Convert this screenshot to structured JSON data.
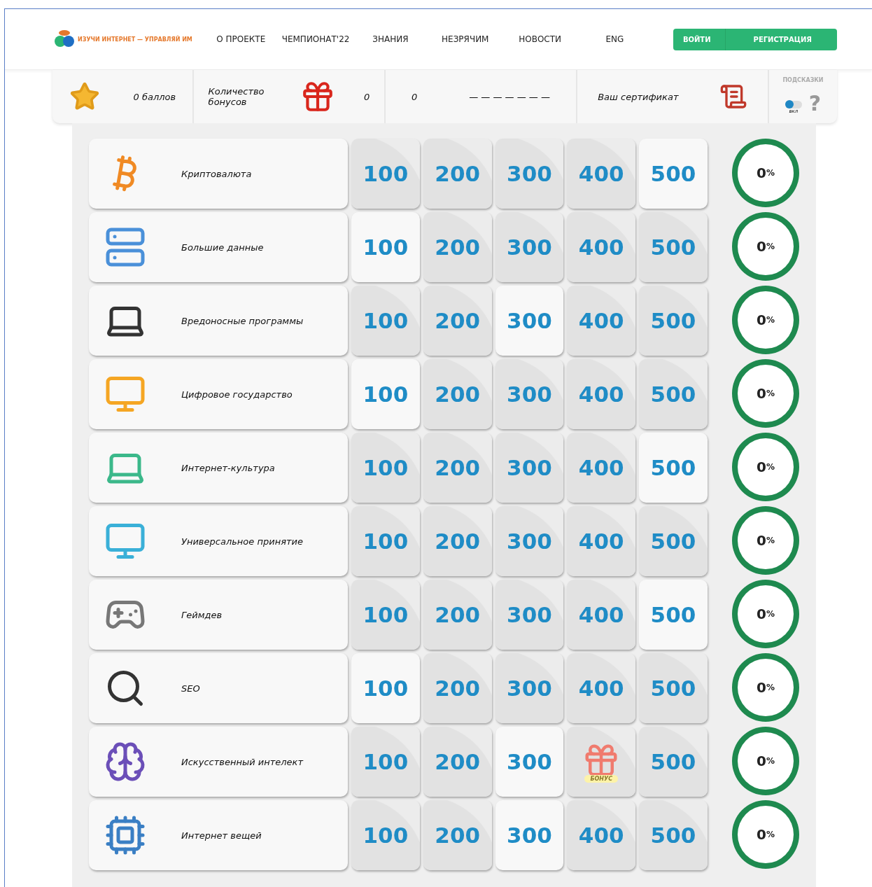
{
  "header": {
    "logo_text": "ИЗУЧИ ИНТЕРНЕТ — УПРАВЛЯЙ ИМ",
    "nav": [
      "О ПРОЕКТЕ",
      "ЧЕМПИОНАТ'22",
      "ЗНАНИЯ",
      "НЕЗРЯЧИМ",
      "НОВОСТИ",
      "ENG"
    ],
    "buttons": [
      "ВОЙТИ",
      "РЕГИСТРАЦИЯ"
    ]
  },
  "stats": {
    "points": "0 баллов",
    "bonus_label": "Количество бонусов",
    "bonus_count": "0",
    "value": "0",
    "dashes": "— — — — — — —",
    "certificate": "Ваш сертификат",
    "hints_label": "ПОДСКАЗКИ",
    "hints_toggle": {
      "on": false,
      "label": "вкл"
    },
    "help": "?"
  },
  "topics": [
    {
      "name": "Криптовалюта",
      "progress": "0",
      "unit": "%",
      "cells": [
        {
          "kind": "number",
          "text": "100",
          "open": false
        },
        {
          "kind": "number",
          "text": "200",
          "open": false
        },
        {
          "kind": "number",
          "text": "300",
          "open": false
        },
        {
          "kind": "number",
          "text": "400",
          "open": false
        },
        {
          "kind": "number",
          "text": "500",
          "open": true
        }
      ]
    },
    {
      "name": "Большие данные",
      "progress": "0",
      "unit": "%",
      "cells": [
        {
          "kind": "number",
          "text": "100",
          "open": true
        },
        {
          "kind": "number",
          "text": "200",
          "open": false
        },
        {
          "kind": "number",
          "text": "300",
          "open": false
        },
        {
          "kind": "number",
          "text": "400",
          "open": false
        },
        {
          "kind": "number",
          "text": "500",
          "open": false
        }
      ]
    },
    {
      "name": "Вредоносные программы",
      "progress": "0",
      "unit": "%",
      "cells": [
        {
          "kind": "number",
          "text": "100",
          "open": false
        },
        {
          "kind": "number",
          "text": "200",
          "open": false
        },
        {
          "kind": "number",
          "text": "300",
          "open": true
        },
        {
          "kind": "number",
          "text": "400",
          "open": false
        },
        {
          "kind": "number",
          "text": "500",
          "open": false
        }
      ]
    },
    {
      "name": "Цифровое государство",
      "progress": "0",
      "unit": "%",
      "cells": [
        {
          "kind": "number",
          "text": "100",
          "open": true
        },
        {
          "kind": "number",
          "text": "200",
          "open": false
        },
        {
          "kind": "number",
          "text": "300",
          "open": false
        },
        {
          "kind": "number",
          "text": "400",
          "open": false
        },
        {
          "kind": "number",
          "text": "500",
          "open": false
        }
      ]
    },
    {
      "name": "Интернет-культура",
      "progress": "0",
      "unit": "%",
      "cells": [
        {
          "kind": "number",
          "text": "100",
          "open": false
        },
        {
          "kind": "number",
          "text": "200",
          "open": false
        },
        {
          "kind": "number",
          "text": "300",
          "open": false
        },
        {
          "kind": "number",
          "text": "400",
          "open": false
        },
        {
          "kind": "number",
          "text": "500",
          "open": true
        }
      ]
    },
    {
      "name": "Универсальное принятие",
      "progress": "0",
      "unit": "%",
      "cells": [
        {
          "kind": "number",
          "text": "100",
          "open": false
        },
        {
          "kind": "number",
          "text": "200",
          "open": false
        },
        {
          "kind": "number",
          "text": "300",
          "open": false
        },
        {
          "kind": "number",
          "text": "400",
          "open": false
        },
        {
          "kind": "number",
          "text": "500",
          "open": false
        }
      ]
    },
    {
      "name": "Геймдев",
      "progress": "0",
      "unit": "%",
      "cells": [
        {
          "kind": "number",
          "text": "100",
          "open": false
        },
        {
          "kind": "number",
          "text": "200",
          "open": false
        },
        {
          "kind": "number",
          "text": "300",
          "open": false
        },
        {
          "kind": "number",
          "text": "400",
          "open": false
        },
        {
          "kind": "number",
          "text": "500",
          "open": true
        }
      ]
    },
    {
      "name": "SEO",
      "progress": "0",
      "unit": "%",
      "cells": [
        {
          "kind": "number",
          "text": "100",
          "open": true
        },
        {
          "kind": "number",
          "text": "200",
          "open": false
        },
        {
          "kind": "number",
          "text": "300",
          "open": false
        },
        {
          "kind": "number",
          "text": "400",
          "open": false
        },
        {
          "kind": "number",
          "text": "500",
          "open": false
        }
      ]
    },
    {
      "name": "Искусственный интелект",
      "progress": "0",
      "unit": "%",
      "cells": [
        {
          "kind": "number",
          "text": "100",
          "open": false
        },
        {
          "kind": "number",
          "text": "200",
          "open": false
        },
        {
          "kind": "number",
          "text": "300",
          "open": true
        },
        {
          "kind": "bonus",
          "text": "БОНУС",
          "open": false
        },
        {
          "kind": "number",
          "text": "500",
          "open": false
        }
      ]
    },
    {
      "name": "Интернет вещей",
      "progress": "0",
      "unit": "%",
      "cells": [
        {
          "kind": "number",
          "text": "100",
          "open": false
        },
        {
          "kind": "number",
          "text": "200",
          "open": false
        },
        {
          "kind": "number",
          "text": "300",
          "open": true
        },
        {
          "kind": "number",
          "text": "400",
          "open": false
        },
        {
          "kind": "number",
          "text": "500",
          "open": false
        }
      ]
    }
  ]
}
